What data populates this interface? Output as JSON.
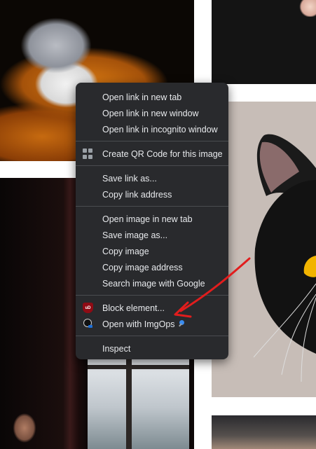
{
  "menu": {
    "group_link": [
      "Open link in new tab",
      "Open link in new window",
      "Open link in incognito window"
    ],
    "qr_label": "Create QR Code for this image",
    "group_save": [
      "Save link as...",
      "Copy link address"
    ],
    "group_image": [
      "Open image in new tab",
      "Save image as...",
      "Copy image",
      "Copy image address",
      "Search image with Google"
    ],
    "block_label": "Block element...",
    "imgops_label": "Open with ImgOps",
    "inspect_label": "Inspect",
    "ublock_badge": "uD"
  },
  "icons": {
    "qr": "qr-code-icon",
    "block": "ublock-origin-icon",
    "imgops": "imgops-icon",
    "imgops_suffix": "pushpin-icon"
  },
  "colors": {
    "menu_bg": "#292a2d",
    "menu_text": "#e8eaed",
    "separator": "#4a4c50",
    "arrow": "#e11d1d"
  }
}
